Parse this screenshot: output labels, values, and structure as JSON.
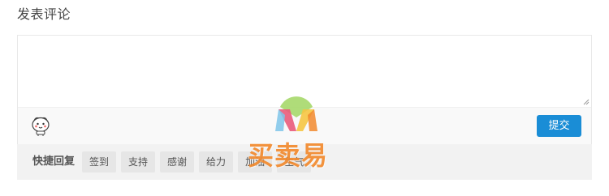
{
  "comment": {
    "title": "发表评论",
    "textarea_value": "",
    "textarea_placeholder": "",
    "emoji_icon": "emoji-face-icon",
    "submit_label": "提交"
  },
  "quick_reply": {
    "label": "快捷回复",
    "tags": [
      "签到",
      "支持",
      "感谢",
      "给力",
      "加油",
      "生气"
    ]
  },
  "watermark": {
    "text": "买卖易"
  },
  "colors": {
    "submit_bg": "#1a8dd6",
    "quick_reply_bg": "#f2f2f2",
    "tag_bg": "#e6e6e6",
    "watermark_text": "#f28a2e"
  }
}
